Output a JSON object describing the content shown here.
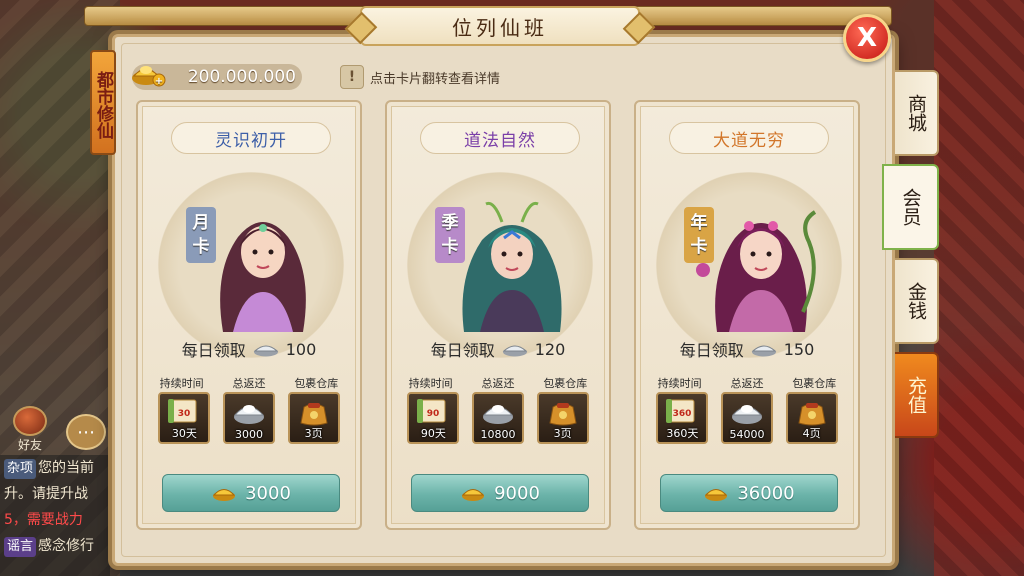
{
  "panel": {
    "title": "位列仙班",
    "side_banner": "都市修仙",
    "currency_value": "200.000.000",
    "hint_text": "点击卡片翻转查看详情",
    "close_label": "X"
  },
  "cards": [
    {
      "title": "灵识初开",
      "title_color": "#3d5fa8",
      "type_label_1": "月",
      "type_label_2": "卡",
      "type_color": "#8a9bb8",
      "daily_label": "每日领取",
      "daily_value": "100",
      "stat_headers": [
        "持续时间",
        "总返还",
        "包裹仓库"
      ],
      "stats": [
        "30天",
        "3000",
        "3页"
      ],
      "scroll_number": "30",
      "price": "3000"
    },
    {
      "title": "道法自然",
      "title_color": "#7a3fa8",
      "type_label_1": "季",
      "type_label_2": "卡",
      "type_color": "#b78ac9",
      "daily_label": "每日领取",
      "daily_value": "120",
      "stat_headers": [
        "持续时间",
        "总返还",
        "包裹仓库"
      ],
      "stats": [
        "90天",
        "10800",
        "3页"
      ],
      "scroll_number": "90",
      "price": "9000"
    },
    {
      "title": "大道无穷",
      "title_color": "#d2762a",
      "type_label_1": "年",
      "type_label_2": "卡",
      "type_color": "#d9a445",
      "daily_label": "每日领取",
      "daily_value": "150",
      "stat_headers": [
        "持续时间",
        "总返还",
        "包裹仓库"
      ],
      "stats": [
        "360天",
        "54000",
        "4页"
      ],
      "scroll_number": "360",
      "price": "36000"
    }
  ],
  "side_tabs": [
    {
      "label": "商城"
    },
    {
      "label": "会员"
    },
    {
      "label": "金钱"
    },
    {
      "label": "充值"
    }
  ],
  "background": {
    "friend_label": "好友",
    "chat_lines": [
      {
        "tag": "杂项",
        "text": "您的当前"
      },
      {
        "tag": "",
        "text": "升。请提升战"
      },
      {
        "tag": "",
        "text": "5，需要战力"
      },
      {
        "tag": "谣言",
        "text": "感念修行"
      }
    ]
  }
}
